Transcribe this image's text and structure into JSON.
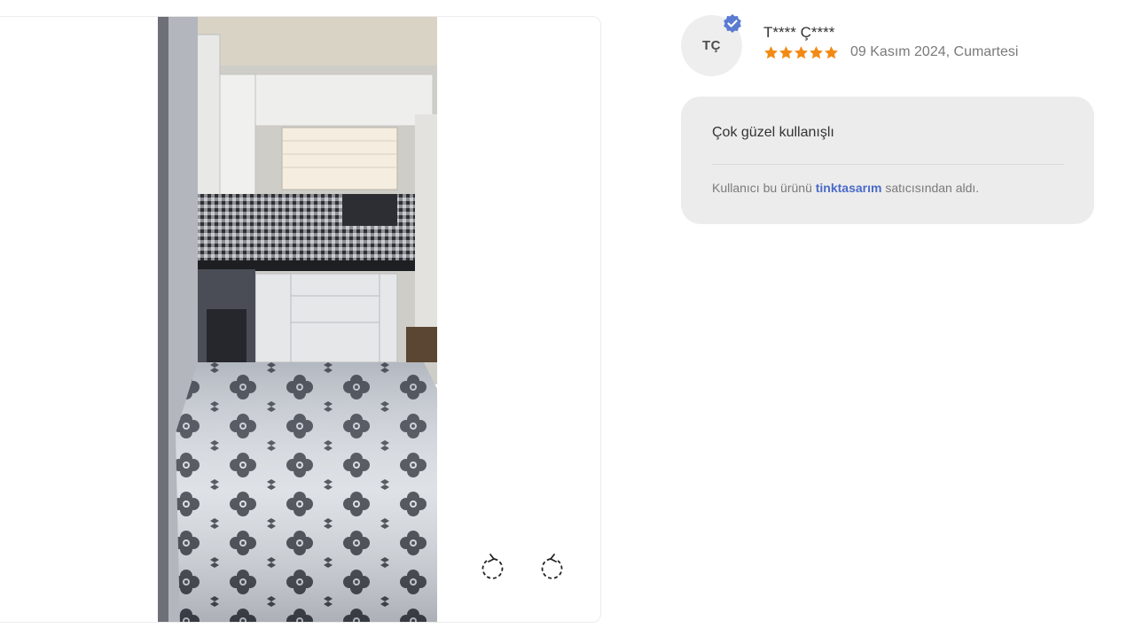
{
  "image_viewer": {
    "photo_alt": "Review photo",
    "controls": [
      {
        "icon": "rotate-left-icon"
      },
      {
        "icon": "rotate-right-icon"
      }
    ]
  },
  "reviewer": {
    "initials": "TÇ",
    "name": "T**** Ç****",
    "verified_icon": "verified-badge-icon",
    "rating": 5,
    "rating_max": 5,
    "star_color": "#f28a14",
    "date": "09 Kasım 2024, Cumartesi"
  },
  "review": {
    "comment": "Çok güzel kullanışlı",
    "seller_prefix": "Kullanıcı bu ürünü",
    "seller_name": "tinktasarım",
    "seller_suffix": "satıcısından aldı."
  },
  "colors": {
    "link": "#4a6ac8",
    "badge": "#5b7ad1",
    "card_bg": "#ececec"
  }
}
